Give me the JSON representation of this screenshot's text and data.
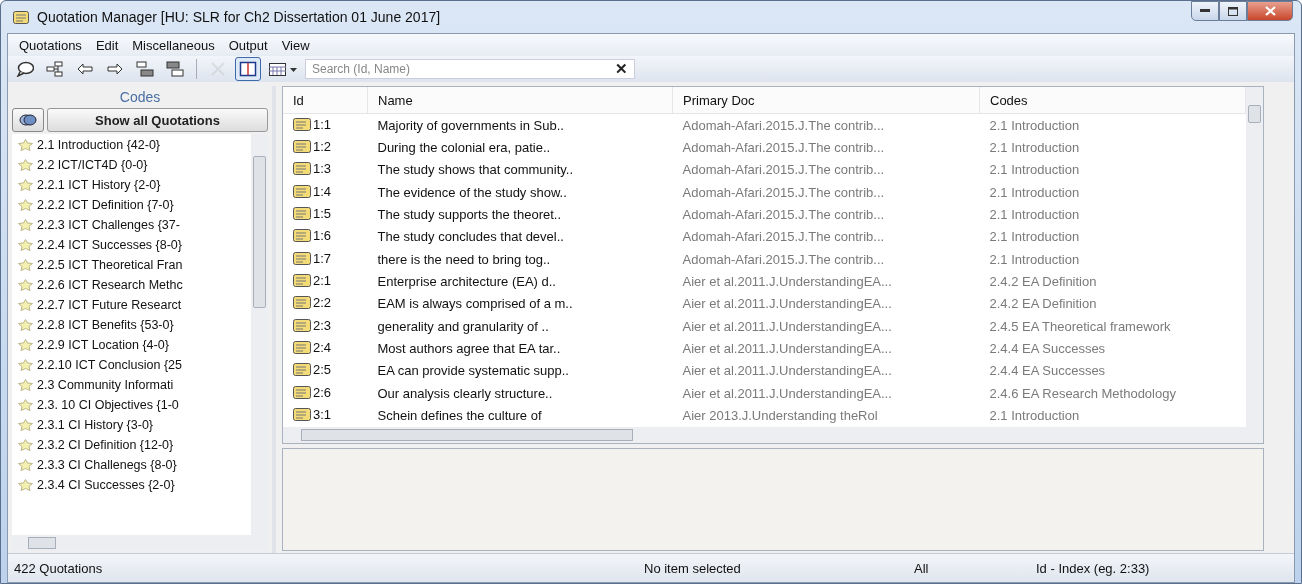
{
  "window": {
    "title": "Quotation Manager [HU: SLR for Ch2 Dissertation 01 June 2017]"
  },
  "menu": [
    "Quotations",
    "Edit",
    "Miscellaneous",
    "Output",
    "View"
  ],
  "toolbar": [
    {
      "kind": "bubble",
      "disabled": false,
      "selected": false
    },
    {
      "kind": "tree",
      "disabled": false,
      "selected": false
    },
    {
      "kind": "back",
      "disabled": false,
      "selected": false
    },
    {
      "kind": "forward",
      "disabled": false,
      "selected": false
    },
    {
      "kind": "layout1",
      "disabled": false,
      "selected": false
    },
    {
      "kind": "layout2",
      "disabled": false,
      "selected": false
    },
    {
      "kind": "sep"
    },
    {
      "kind": "delete",
      "disabled": true,
      "selected": false
    },
    {
      "kind": "panel",
      "disabled": false,
      "selected": true
    },
    {
      "kind": "grid",
      "disabled": false,
      "selected": false
    }
  ],
  "search": {
    "placeholder": "Search (Id, Name)",
    "clear": "✕"
  },
  "codes_panel": {
    "title": "Codes",
    "show_all": "Show all Quotations",
    "items": [
      "2.1 Introduction {42-0}",
      "2.2 ICT/ICT4D {0-0}",
      "2.2.1 ICT History {2-0}",
      "2.2.2 ICT Definition {7-0}",
      "2.2.3 ICT Challenges {37-",
      "2.2.4 ICT Successes {8-0}",
      "2.2.5 ICT Theoretical Fran",
      "2.2.6 ICT Research Methc",
      "2.2.7 ICT Future Researct",
      "2.2.8 ICT Benefits {53-0}",
      "2.2.9 ICT Location {4-0}",
      "2.2.10 ICT Conclusion {25",
      "2.3 Community Informati",
      "2.3. 10 CI Objectives {1-0",
      "2.3.1 CI History {3-0}",
      "2.3.2 CI Definition {12-0}",
      "2.3.3 CI Challenegs {8-0}",
      "2.3.4 CI Successes {2-0}"
    ]
  },
  "table": {
    "columns": [
      "Id",
      "Name",
      "Primary Doc",
      "Codes"
    ],
    "rows": [
      [
        "1:1",
        "Majority of governments in Sub..",
        "Adomah-Afari.2015.J.The contrib...",
        "2.1 Introduction"
      ],
      [
        "1:2",
        "During the colonial era, patie..",
        "Adomah-Afari.2015.J.The contrib...",
        "2.1 Introduction"
      ],
      [
        "1:3",
        "The study shows that community..",
        "Adomah-Afari.2015.J.The contrib...",
        "2.1 Introduction"
      ],
      [
        "1:4",
        "The evidence of the study show..",
        "Adomah-Afari.2015.J.The contrib...",
        "2.1 Introduction"
      ],
      [
        "1:5",
        "The study supports the theoret..",
        "Adomah-Afari.2015.J.The contrib...",
        "2.1 Introduction"
      ],
      [
        "1:6",
        "The study concludes that devel..",
        "Adomah-Afari.2015.J.The contrib...",
        "2.1 Introduction"
      ],
      [
        "1:7",
        "there is the need to bring tog..",
        "Adomah-Afari.2015.J.The contrib...",
        "2.1 Introduction"
      ],
      [
        "2:1",
        "Enterprise architecture (EA) d..",
        "Aier et al.2011.J.UnderstandingEA...",
        "2.4.2 EA Definition"
      ],
      [
        "2:2",
        "EAM is always comprised of a m..",
        "Aier et al.2011.J.UnderstandingEA...",
        "2.4.2 EA Definition"
      ],
      [
        "2:3",
        "generality and granularity of ..",
        "Aier et al.2011.J.UnderstandingEA...",
        "2.4.5 EA Theoretical framework"
      ],
      [
        "2:4",
        "Most authors agree that EA tar..",
        "Aier et al.2011.J.UnderstandingEA...",
        "2.4.4 EA Successes"
      ],
      [
        "2:5",
        "EA can provide systematic supp..",
        "Aier et al.2011.J.UnderstandingEA...",
        "2.4.4 EA Successes"
      ],
      [
        "2:6",
        "Our analysis clearly structure..",
        "Aier et al.2011.J.UnderstandingEA...",
        "2.4.6 EA Research Methodology"
      ],
      [
        "3:1",
        "Schein defines the culture of",
        "Aier 2013.J.Understanding theRol",
        "2.1 Introduction"
      ]
    ]
  },
  "status_bar": [
    "422 Quotations",
    "No item selected",
    "All",
    "Id - Index (eg. 2:33)"
  ]
}
